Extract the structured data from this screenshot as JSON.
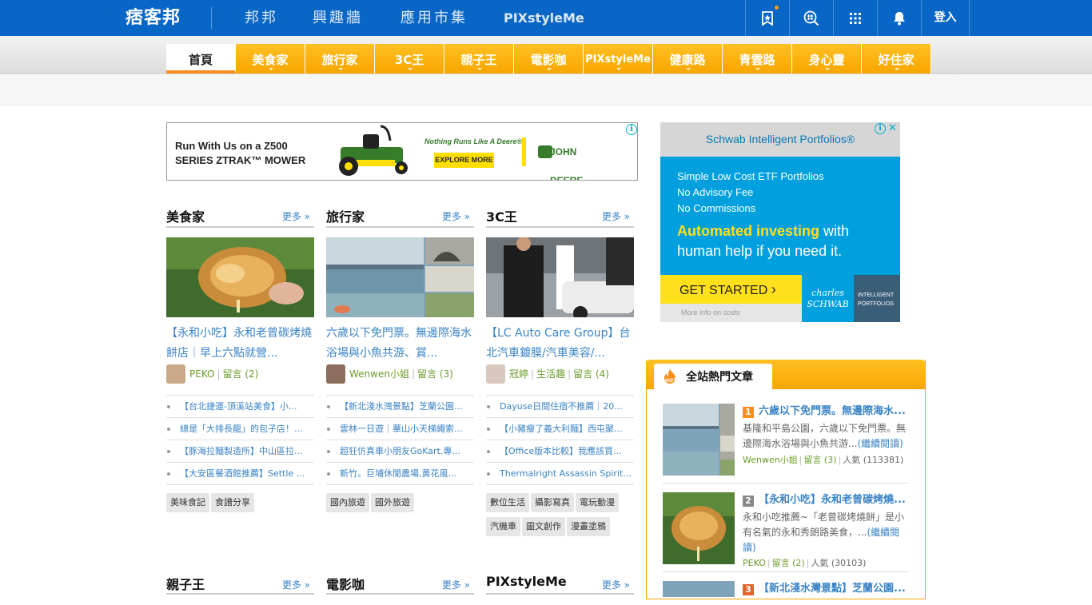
{
  "topbar": {
    "logo": "痞客邦",
    "nav": [
      "邦邦",
      "興趣牆",
      "應用市集",
      "PIXstyleMe"
    ],
    "icons": [
      "bookmark-star-icon",
      "search-hash-icon",
      "apps-grid-icon",
      "bell-icon"
    ],
    "login": "登入",
    "colors": {
      "bg": "#0866c6",
      "badge": "#ff9a16"
    }
  },
  "categories": [
    "首頁",
    "美食家",
    "旅行家",
    "3C王",
    "親子王",
    "電影咖",
    "PIXstyleMe",
    "健康路",
    "青雲路",
    "身心靈",
    "好住家"
  ],
  "ads": {
    "left": {
      "headline": "Run With Us on a Z500 SERIES ZTRAK™ MOWER",
      "tagline": "Nothing Runs Like A Deere®",
      "button": "EXPLORE MORE",
      "brand": "JOHN DEERE"
    },
    "right": {
      "title": "Schwab Intelligent Portfolios®",
      "line1": "Simple Low Cost ETF Portfolios",
      "line2": "No Advisory Fee",
      "line3": "No Commissions",
      "headline_a": "Automated investing",
      "headline_b": "with human help if you need it.",
      "cta": "GET STARTED",
      "more": "More info on costs",
      "brand": "charles SCHWAB",
      "brand2": "INTELLIGENT PORTFOLIOS"
    }
  },
  "columns": [
    {
      "title": "美食家",
      "more": "更多 »",
      "article": "【永和小吃】永和老曾碳烤燒餅店｜早上六點就營...",
      "author": "PEKO",
      "comments": "留言 (2)",
      "list": [
        "【台北捷運-頂溪站美食】小...",
        "總是「大排長龍」的包子店！...",
        "【豚海拉麵製造所】中山區拉...",
        "【大安區餐酒館推薦】Settle ..."
      ],
      "tags": [
        "美味食記",
        "食譜分享"
      ]
    },
    {
      "title": "旅行家",
      "more": "更多 »",
      "article": "六歲以下免門票。無邊際海水浴場與小魚共游、賞...",
      "author": "Wenwen小姐",
      "comments": "留言 (3)",
      "list": [
        "【新北淺水灣景點】芝蘭公園...",
        "雲林一日遊｜華山小天梯繩索...",
        "超狂仿真車小朋友GoKart.專...",
        "新竹。巨埔休閒農場,黃花風..."
      ],
      "tags": [
        "國內旅遊",
        "國外旅遊"
      ]
    },
    {
      "title": "3C王",
      "more": "更多 »",
      "article": "【LC Auto Care Group】台北汽車鍍膜/汽車美容/...",
      "author": "冠婷",
      "category": "生活趣",
      "comments": "留言 (4)",
      "list": [
        "Dayuse日間住宿不推薦｜20...",
        "【小豬瘦了義大利麵】西屯聚...",
        "【Office版本比較】我應該買...",
        "Thermalright Assassin Spirit ..."
      ],
      "tags": [
        "數位生活",
        "攝影寫真",
        "電玩動漫",
        "汽機車",
        "圖文創作",
        "漫畫塗鴉"
      ]
    }
  ],
  "columns_row2": [
    {
      "title": "親子王",
      "more": "更多 »"
    },
    {
      "title": "電影咖",
      "more": "更多 »"
    },
    {
      "title": "PIXstyleMe",
      "more": "更多 »"
    }
  ],
  "hot": {
    "title": "全站熱門文章",
    "items": [
      {
        "rank": "1",
        "title": "六歲以下免門票。無邊際海水...",
        "excerpt": "基隆和平島公園，六歲以下免門票。無邊際海水浴場與小魚共游...",
        "read": "(繼續閱讀)",
        "author": "Wenwen小姐",
        "comments": "留言 (3)",
        "views": "人氣 (113381)"
      },
      {
        "rank": "2",
        "title": "【永和小吃】永和老曾碳烤燒...",
        "excerpt": "永和小吃推薦~「老曾碳烤燒餅」是小有名氣的永和秀朗路美食，...",
        "read": "(繼續閱讀)",
        "author": "PEKO",
        "comments": "留言 (2)",
        "views": "人氣 (30103)"
      },
      {
        "rank": "3",
        "title": "【新北淺水灣景點】芝蘭公園..."
      }
    ],
    "colors": {
      "rank1": "#f78f1e",
      "rank2": "#888888",
      "rank3": "#e2642c"
    }
  }
}
